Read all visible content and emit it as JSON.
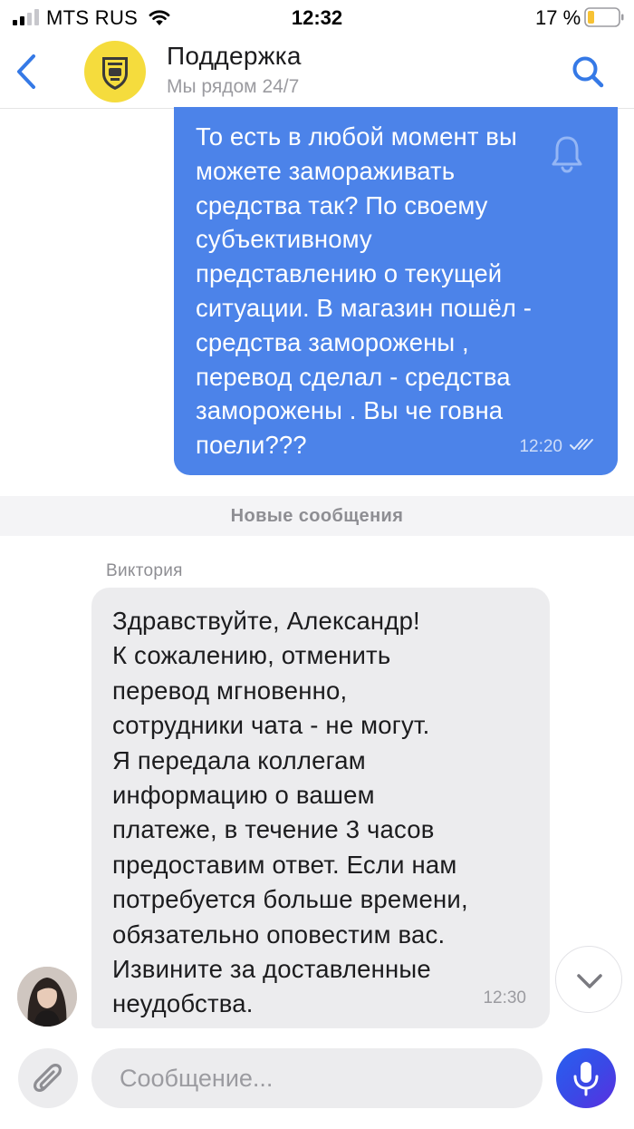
{
  "status_bar": {
    "carrier": "MTS RUS",
    "time": "12:32",
    "battery": "17 %"
  },
  "header": {
    "title": "Поддержка",
    "subtitle": "Мы рядом 24/7",
    "icons": [
      "chevron-left-icon",
      "bank-logo",
      "search-icon"
    ]
  },
  "messages": {
    "outgoing": {
      "text": "То есть в любой момент вы\nможете замораживать\nсредства так? По своему\nсубъективному\nпредставлению о текущей\nситуации. В магазин пошёл -\nсредства заморожены ,\nперевод сделал - средства\nзаморожены . Вы че говна\nпоели???",
      "time": "12:20"
    },
    "divider_label": "Новые сообщения",
    "incoming": {
      "sender": "Виктория",
      "text": "Здравствуйте, Александр!\nК сожалению, отменить\nперевод мгновенно,\nсотрудники чата - не могут.\nЯ передала коллегам\nинформацию о вашем\nплатеже, в течение 3 часов\nпредоставим ответ. Если нам\nпотребуется больше времени,\nобязательно оповестим вас.\nИзвините за доставленные\nнеудобства.",
      "time": "12:30"
    }
  },
  "composer": {
    "placeholder": "Сообщение..."
  },
  "colors": {
    "accent": "#4c83e9",
    "outgoing_bubble": "#4c83e9",
    "incoming_bubble": "#ececee",
    "logo_yellow": "#f5dc3d",
    "mic_gradient_start": "#2860f0",
    "mic_gradient_end": "#5b2fe0"
  }
}
